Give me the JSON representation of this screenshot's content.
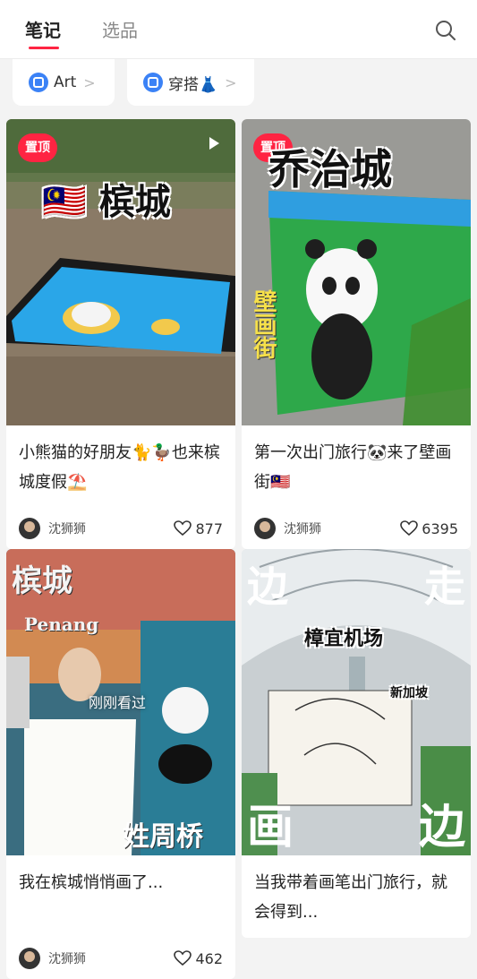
{
  "tabs": {
    "notes": "笔记",
    "picks": "选品"
  },
  "chips": [
    {
      "label": "Art",
      "chevron": ">"
    },
    {
      "label": "穿搭👗",
      "chevron": ">"
    }
  ],
  "cards": [
    {
      "pinned_label": "置顶",
      "cover_title": "🇲🇾 槟城",
      "caption": "小熊猫的好朋友🐈🦆也来槟城度假⛱️",
      "author": "沈狮狮",
      "likes": "877"
    },
    {
      "pinned_label": "置顶",
      "cover_title": "乔治城",
      "cover_sub": "壁画街",
      "caption": "第一次出门旅行🐼来了壁画街🇲🇾",
      "author": "沈狮狮",
      "likes": "6395"
    },
    {
      "cover_title": "槟城",
      "cover_sub2": "Penang",
      "cover_note": "刚刚看过",
      "cover_bottom": "姓周桥",
      "caption": "我在槟城悄悄画了...",
      "author": "沈狮狮",
      "likes": "462"
    },
    {
      "cover_title_left": "边",
      "cover_title_right": "走",
      "cover_mid": "樟宜机场",
      "cover_tag": "新加坡",
      "cover_bottom_left": "画",
      "cover_bottom_right": "边",
      "caption": "当我带着画笔出门旅行，就会得到...",
      "author": "",
      "likes": ""
    }
  ],
  "colors": {
    "accent": "#ff2442",
    "chip_icon": "#3b82f6"
  }
}
